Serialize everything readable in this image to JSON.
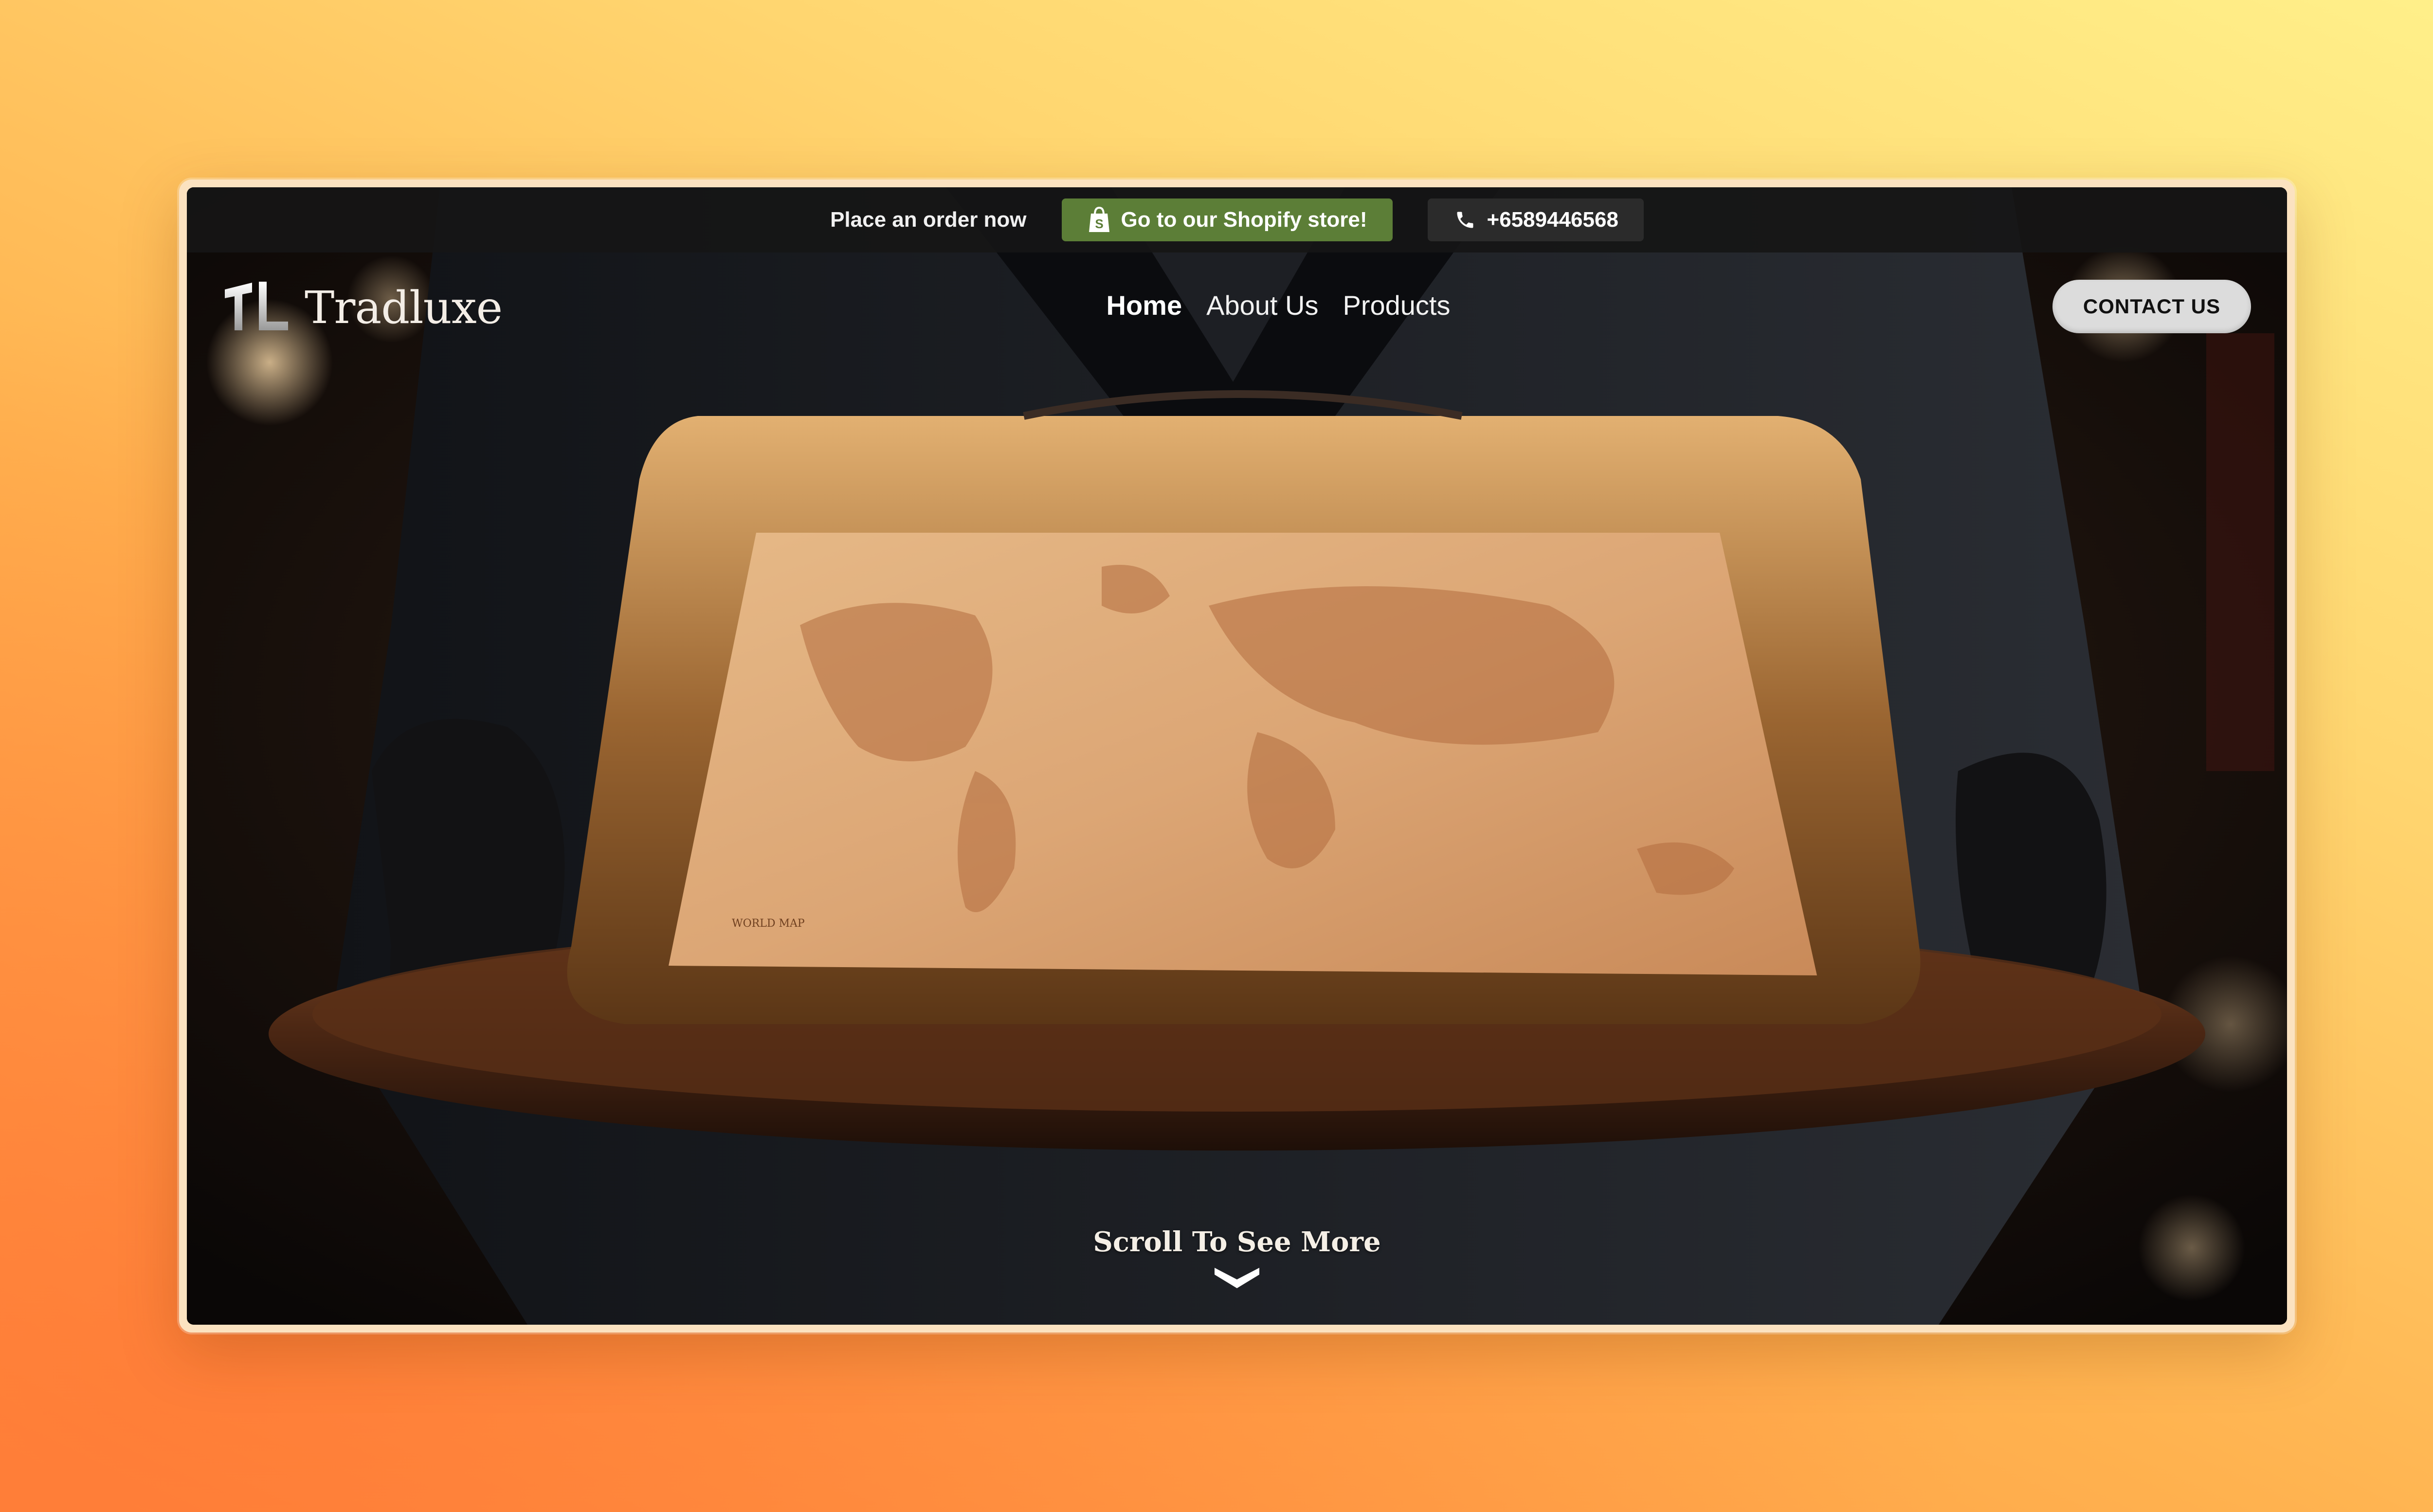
{
  "topbar": {
    "order_text": "Place an order now",
    "shopify_label": "Go to our Shopify store!",
    "phone_number": "+6589446568"
  },
  "brand": {
    "name": "Tradluxe"
  },
  "nav": {
    "items": [
      {
        "label": "Home",
        "active": true
      },
      {
        "label": "About Us",
        "active": false
      },
      {
        "label": "Products",
        "active": false
      }
    ]
  },
  "contact": {
    "label": "CONTACT US"
  },
  "hero": {
    "scroll_text": "Scroll To See More",
    "map_caption": "WORLD MAP"
  },
  "colors": {
    "shopify_green": "#5c7e37",
    "topbar_bg": "#161616",
    "contact_bg": "#dcdcdc"
  },
  "icons": [
    "shopify-bag-icon",
    "phone-icon",
    "logo-mark-icon",
    "chevron-down-icon"
  ]
}
